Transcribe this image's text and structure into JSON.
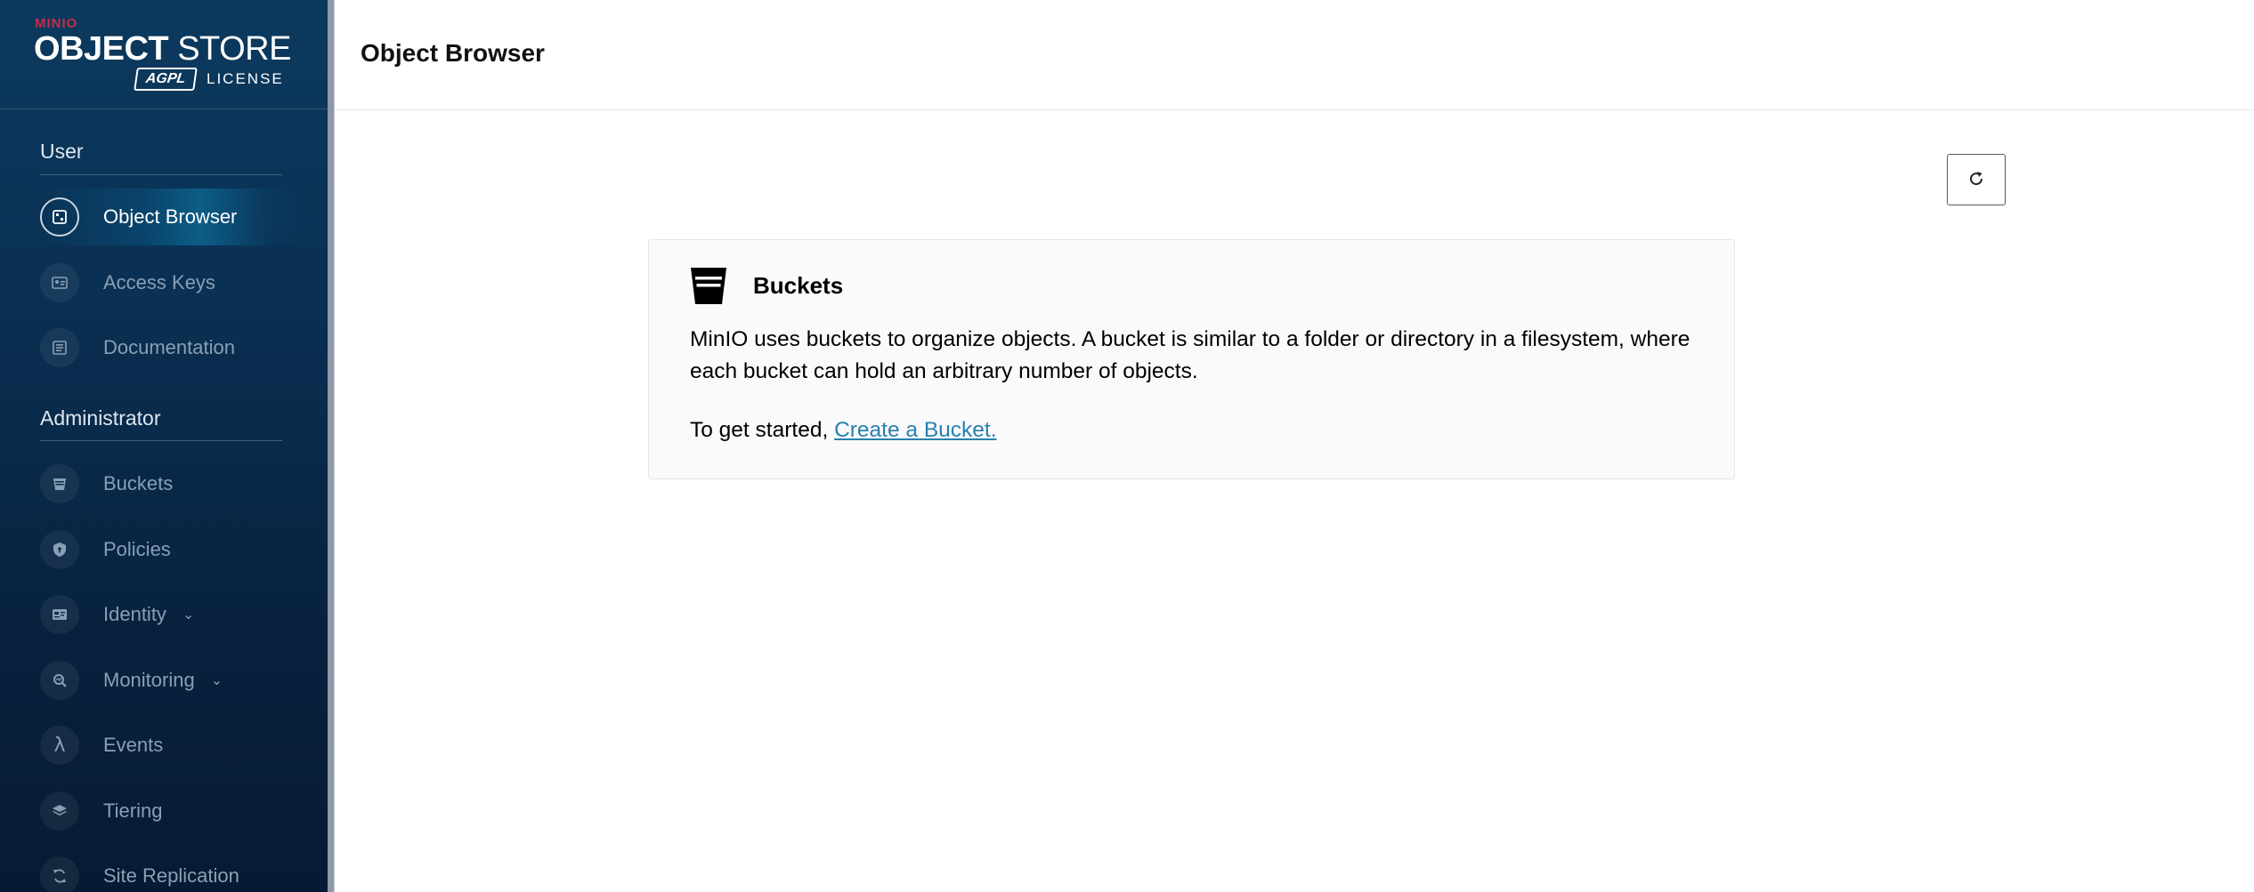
{
  "logo": {
    "brand": "MINIO",
    "title_bold": "OBJECT",
    "title_light": " STORE",
    "badge": "AGPL",
    "license": "LICENSE"
  },
  "sidebar": {
    "user_section": "User",
    "user_items": [
      {
        "label": "Object Browser",
        "icon": "object-browser-icon",
        "active": true
      },
      {
        "label": "Access Keys",
        "icon": "access-keys-icon"
      },
      {
        "label": "Documentation",
        "icon": "documentation-icon"
      }
    ],
    "admin_section": "Administrator",
    "admin_items": [
      {
        "label": "Buckets",
        "icon": "bucket-icon"
      },
      {
        "label": "Policies",
        "icon": "shield-icon"
      },
      {
        "label": "Identity",
        "icon": "id-card-icon",
        "expandable": true
      },
      {
        "label": "Monitoring",
        "icon": "monitoring-icon",
        "expandable": true
      },
      {
        "label": "Events",
        "icon": "lambda-icon"
      },
      {
        "label": "Tiering",
        "icon": "layers-icon"
      },
      {
        "label": "Site Replication",
        "icon": "replication-icon"
      }
    ]
  },
  "header": {
    "title": "Object Browser"
  },
  "empty_state": {
    "title": "Buckets",
    "description": "MinIO uses buckets to organize objects. A bucket is similar to a folder or directory in a filesystem, where each bucket can hold an arbitrary number of objects.",
    "cta_prefix": "To get started, ",
    "cta_link": "Create a Bucket."
  },
  "colors": {
    "sidebar_bg": "#0a2f52",
    "brand_red": "#c72c48",
    "link": "#2781b0"
  }
}
